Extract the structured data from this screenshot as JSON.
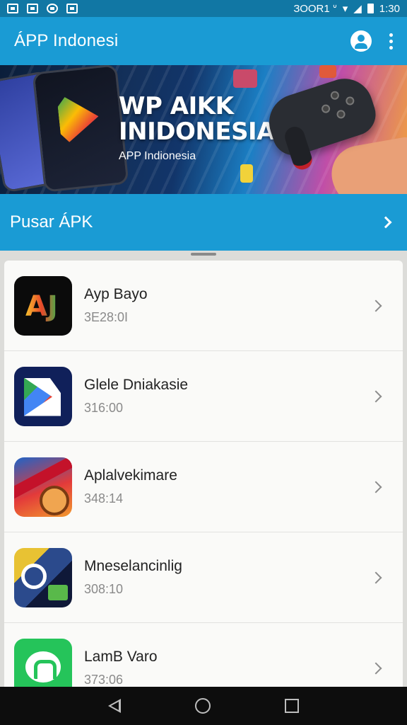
{
  "status_bar": {
    "left_icons": [
      "gallery-icon",
      "photo-icon",
      "location-icon",
      "camera-icon"
    ],
    "indicators": "ЗООR1 ᐡ",
    "time": "1:30"
  },
  "app_bar": {
    "title": "ÁPP Indonesi",
    "actions": [
      "account-icon",
      "more-icon"
    ]
  },
  "banner": {
    "headline_line1": "WP AIKK",
    "headline_line2": "INIDONESIA",
    "subtitle": "APP Indionesia"
  },
  "apk_section": {
    "title": "Pusar ÁPK"
  },
  "apps": [
    {
      "name": "Ayp Bayo",
      "size": "3E28:0I",
      "icon": "aj-app-icon"
    },
    {
      "name": "Glele Dniakasie",
      "size": "316:00",
      "icon": "play-store-icon"
    },
    {
      "name": "Aplalvekimare",
      "size": "348:14",
      "icon": "game-mascot-icon"
    },
    {
      "name": "Mneselancinlig",
      "size": "308:10",
      "icon": "tools-icon"
    },
    {
      "name": "LamB Varo",
      "size": "373:06",
      "icon": "chat-bubble-icon"
    }
  ],
  "colors": {
    "status_bar": "#1177a4",
    "app_bar": "#1a9bd4",
    "list_background": "#fafaf8",
    "nav_bar": "#0d0d0d"
  },
  "nav_bar": {
    "buttons": [
      "back-icon",
      "home-icon",
      "recent-apps-icon"
    ]
  }
}
